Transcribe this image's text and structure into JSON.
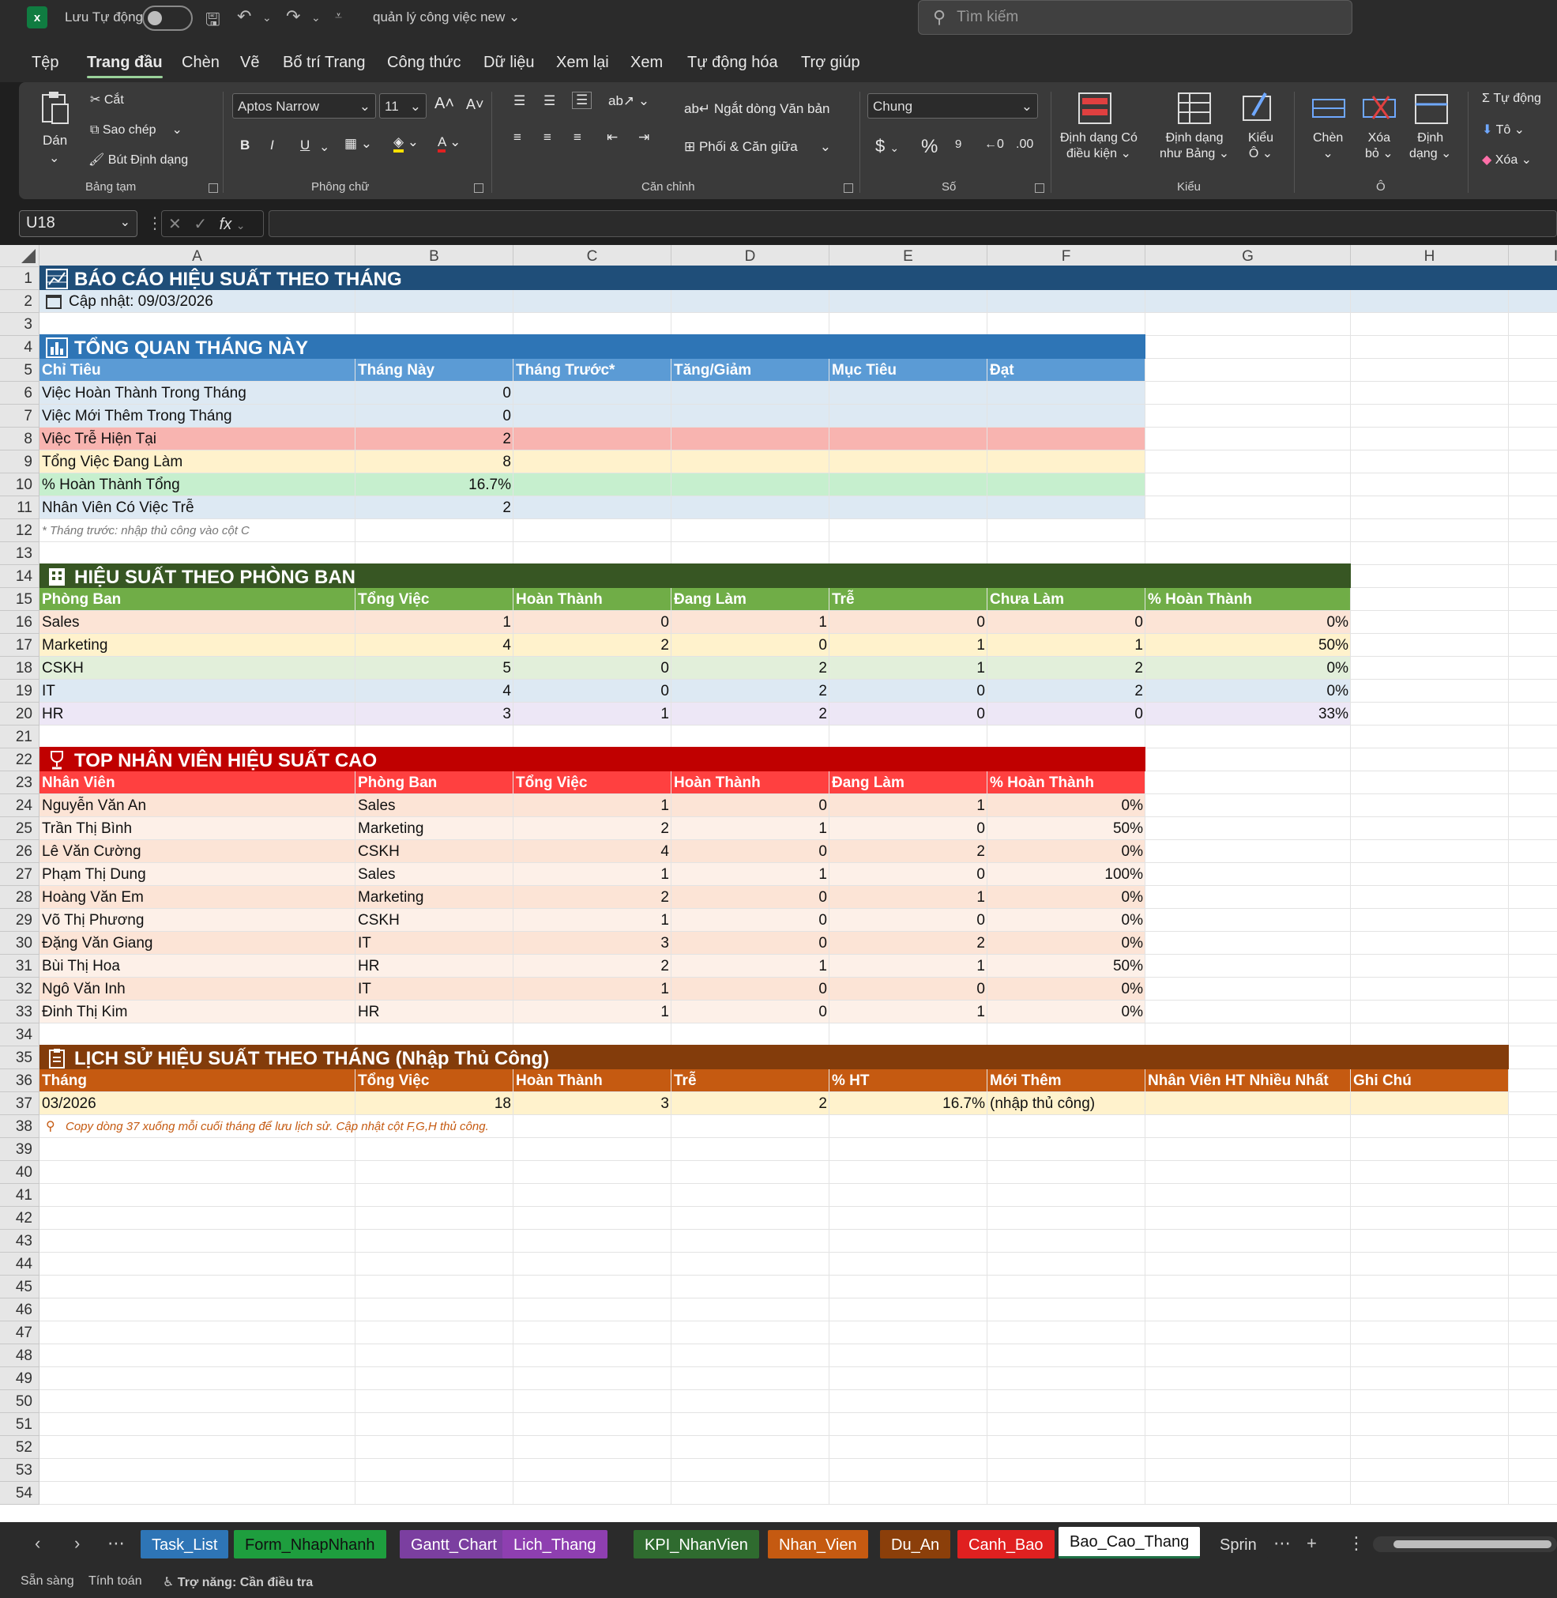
{
  "titlebar": {
    "autosave_label": "Lưu Tự động",
    "doc_title": "quản lý công việc new",
    "search_placeholder": "Tìm kiếm"
  },
  "menu": [
    "Tệp",
    "Trang đầu",
    "Chèn",
    "Vẽ",
    "Bố trí Trang",
    "Công thức",
    "Dữ liệu",
    "Xem lại",
    "Xem",
    "Tự động hóa",
    "Trợ giúp"
  ],
  "ribbon": {
    "clipboard": {
      "paste": "Dán",
      "cut": "Cắt",
      "copy": "Sao chép",
      "format_painter": "Bút Định dạng",
      "label": "Bảng tạm"
    },
    "font": {
      "name": "Aptos Narrow",
      "size": "11",
      "label": "Phông chữ",
      "bold": "B",
      "italic": "I",
      "underline": "U"
    },
    "align": {
      "wrap": "Ngắt dòng Văn bản",
      "merge": "Phối & Căn giữa",
      "label": "Căn chỉnh"
    },
    "number": {
      "format": "Chung",
      "label": "Số"
    },
    "styles": {
      "cond_a": "Định dạng Có",
      "cond_b": "điều kiện",
      "table_a": "Định dạng",
      "table_b": "như Bảng",
      "cell_a": "Kiểu",
      "cell_b": "Ô",
      "label": "Kiểu"
    },
    "cells": {
      "insert": "Chèn",
      "delete_a": "Xóa",
      "delete_b": "bỏ",
      "format_a": "Định",
      "format_b": "dạng",
      "label": "Ô"
    },
    "editing": {
      "autosum": "Tự động",
      "fill": "Tô",
      "clear": "Xóa"
    }
  },
  "formula": {
    "name_box": "U18",
    "fx": "fx",
    "content": ""
  },
  "columns": [
    "A",
    "B",
    "C",
    "D",
    "E",
    "F",
    "G",
    "H",
    "I"
  ],
  "rows": [
    "1",
    "2",
    "3",
    "4",
    "5",
    "6",
    "7",
    "8",
    "9",
    "10",
    "11",
    "12",
    "13",
    "14",
    "15",
    "16",
    "17",
    "18",
    "19",
    "20",
    "21",
    "22",
    "23",
    "24",
    "25",
    "26",
    "27",
    "28",
    "29",
    "30",
    "31",
    "32",
    "33",
    "34",
    "35",
    "36",
    "37",
    "38",
    "39",
    "40",
    "41",
    "42",
    "43",
    "44",
    "45",
    "46",
    "47",
    "48",
    "49",
    "50",
    "51",
    "52",
    "53",
    "54"
  ],
  "sheet": {
    "title": "BÁO CÁO HIỆU SUẤT THEO THÁNG",
    "updated": "Cập nhật: 09/03/2026",
    "overview": {
      "title": "TỔNG QUAN THÁNG NÀY",
      "headers": [
        "Chỉ Tiêu",
        "Tháng Này",
        "Tháng Trước*",
        "Tăng/Giảm",
        "Mục Tiêu",
        "Đạt"
      ],
      "rows": [
        [
          "Việc Hoàn Thành Trong Tháng",
          "0"
        ],
        [
          "Việc Mới Thêm Trong Tháng",
          "0"
        ],
        [
          "Việc Trễ Hiện Tại",
          "2"
        ],
        [
          "Tổng Việc Đang Làm",
          "8"
        ],
        [
          "% Hoàn Thành Tổng",
          "16.7%"
        ],
        [
          "Nhân Viên Có Việc Trễ",
          "2"
        ]
      ],
      "note": "* Tháng trước: nhập thủ công vào cột C"
    },
    "departments": {
      "title": "HIỆU SUẤT THEO PHÒNG BAN",
      "headers": [
        "Phòng Ban",
        "Tổng Việc",
        "Hoàn Thành",
        "Đang Làm",
        "Trễ",
        "Chưa Làm",
        "% Hoàn Thành"
      ],
      "rows": [
        [
          "Sales",
          "1",
          "0",
          "1",
          "0",
          "0",
          "0%"
        ],
        [
          "Marketing",
          "4",
          "2",
          "0",
          "1",
          "1",
          "50%"
        ],
        [
          "CSKH",
          "5",
          "0",
          "2",
          "1",
          "2",
          "0%"
        ],
        [
          "IT",
          "4",
          "0",
          "2",
          "0",
          "2",
          "0%"
        ],
        [
          "HR",
          "3",
          "1",
          "2",
          "0",
          "0",
          "33%"
        ]
      ]
    },
    "top": {
      "title": "TOP NHÂN VIÊN HIỆU SUẤT CAO",
      "headers": [
        "Nhân Viên",
        "Phòng Ban",
        "Tổng Việc",
        "Hoàn Thành",
        "Đang Làm",
        "% Hoàn Thành"
      ],
      "rows": [
        [
          "Nguyễn Văn An",
          "Sales",
          "1",
          "0",
          "1",
          "0%"
        ],
        [
          "Trần Thị Bình",
          "Marketing",
          "2",
          "1",
          "0",
          "50%"
        ],
        [
          "Lê Văn Cường",
          "CSKH",
          "4",
          "0",
          "2",
          "0%"
        ],
        [
          "Phạm Thị Dung",
          "Sales",
          "1",
          "1",
          "0",
          "100%"
        ],
        [
          "Hoàng Văn Em",
          "Marketing",
          "2",
          "0",
          "1",
          "0%"
        ],
        [
          "Võ Thị Phương",
          "CSKH",
          "1",
          "0",
          "0",
          "0%"
        ],
        [
          "Đặng Văn Giang",
          "IT",
          "3",
          "0",
          "2",
          "0%"
        ],
        [
          "Bùi Thị Hoa",
          "HR",
          "2",
          "1",
          "1",
          "50%"
        ],
        [
          "Ngô Văn Inh",
          "IT",
          "1",
          "0",
          "0",
          "0%"
        ],
        [
          "Đinh Thị Kim",
          "HR",
          "1",
          "0",
          "1",
          "0%"
        ]
      ]
    },
    "history": {
      "title": "LỊCH SỬ HIỆU SUẤT THEO THÁNG (Nhập Thủ Công)",
      "headers": [
        "Tháng",
        "Tổng Việc",
        "Hoàn Thành",
        "Trễ",
        "% HT",
        "Mới Thêm",
        "Nhân Viên HT Nhiều Nhất",
        "Ghi Chú"
      ],
      "row": [
        "03/2026",
        "18",
        "3",
        "2",
        "16.7%",
        "(nhập thủ công)"
      ],
      "note": "Copy dòng 37 xuống mỗi cuối tháng để lưu lịch sử. Cập nhật cột F,G,H thủ công."
    }
  },
  "tabs": [
    {
      "label": "Task_List",
      "color": "#2e75b6",
      "text": "#ffffff"
    },
    {
      "label": "Form_NhapNhanh",
      "color": "#1e9e3e",
      "text": "#111111"
    },
    {
      "label": "Gantt_Chart",
      "color": "#7b3fa0",
      "text": "#ffffff"
    },
    {
      "label": "Lich_Thang",
      "color": "#8e3fb0",
      "text": "#ffffff"
    },
    {
      "label": "KPI_NhanVien",
      "color": "#2f6b2f",
      "text": "#ffffff"
    },
    {
      "label": "Nhan_Vien",
      "color": "#c55a11",
      "text": "#ffffff"
    },
    {
      "label": "Du_An",
      "color": "#8b3f0a",
      "text": "#ffffff"
    },
    {
      "label": "Canh_Bao",
      "color": "#e02020",
      "text": "#ffffff"
    },
    {
      "label": "Bao_Cao_Thang",
      "color": "#ffffff",
      "text": "#111111"
    },
    {
      "label": "Sprin",
      "color": "#2b2b2b",
      "text": "#dddddd"
    }
  ],
  "status": {
    "ready": "Sẵn sàng",
    "calc": "Tính toán",
    "access": "Trợ năng: Cần điều tra"
  },
  "colors": {
    "title_band": "#1f4e79",
    "overview": "#2e75b6",
    "departments": "#375623",
    "top": "#c00000",
    "history": "#833c0b"
  }
}
